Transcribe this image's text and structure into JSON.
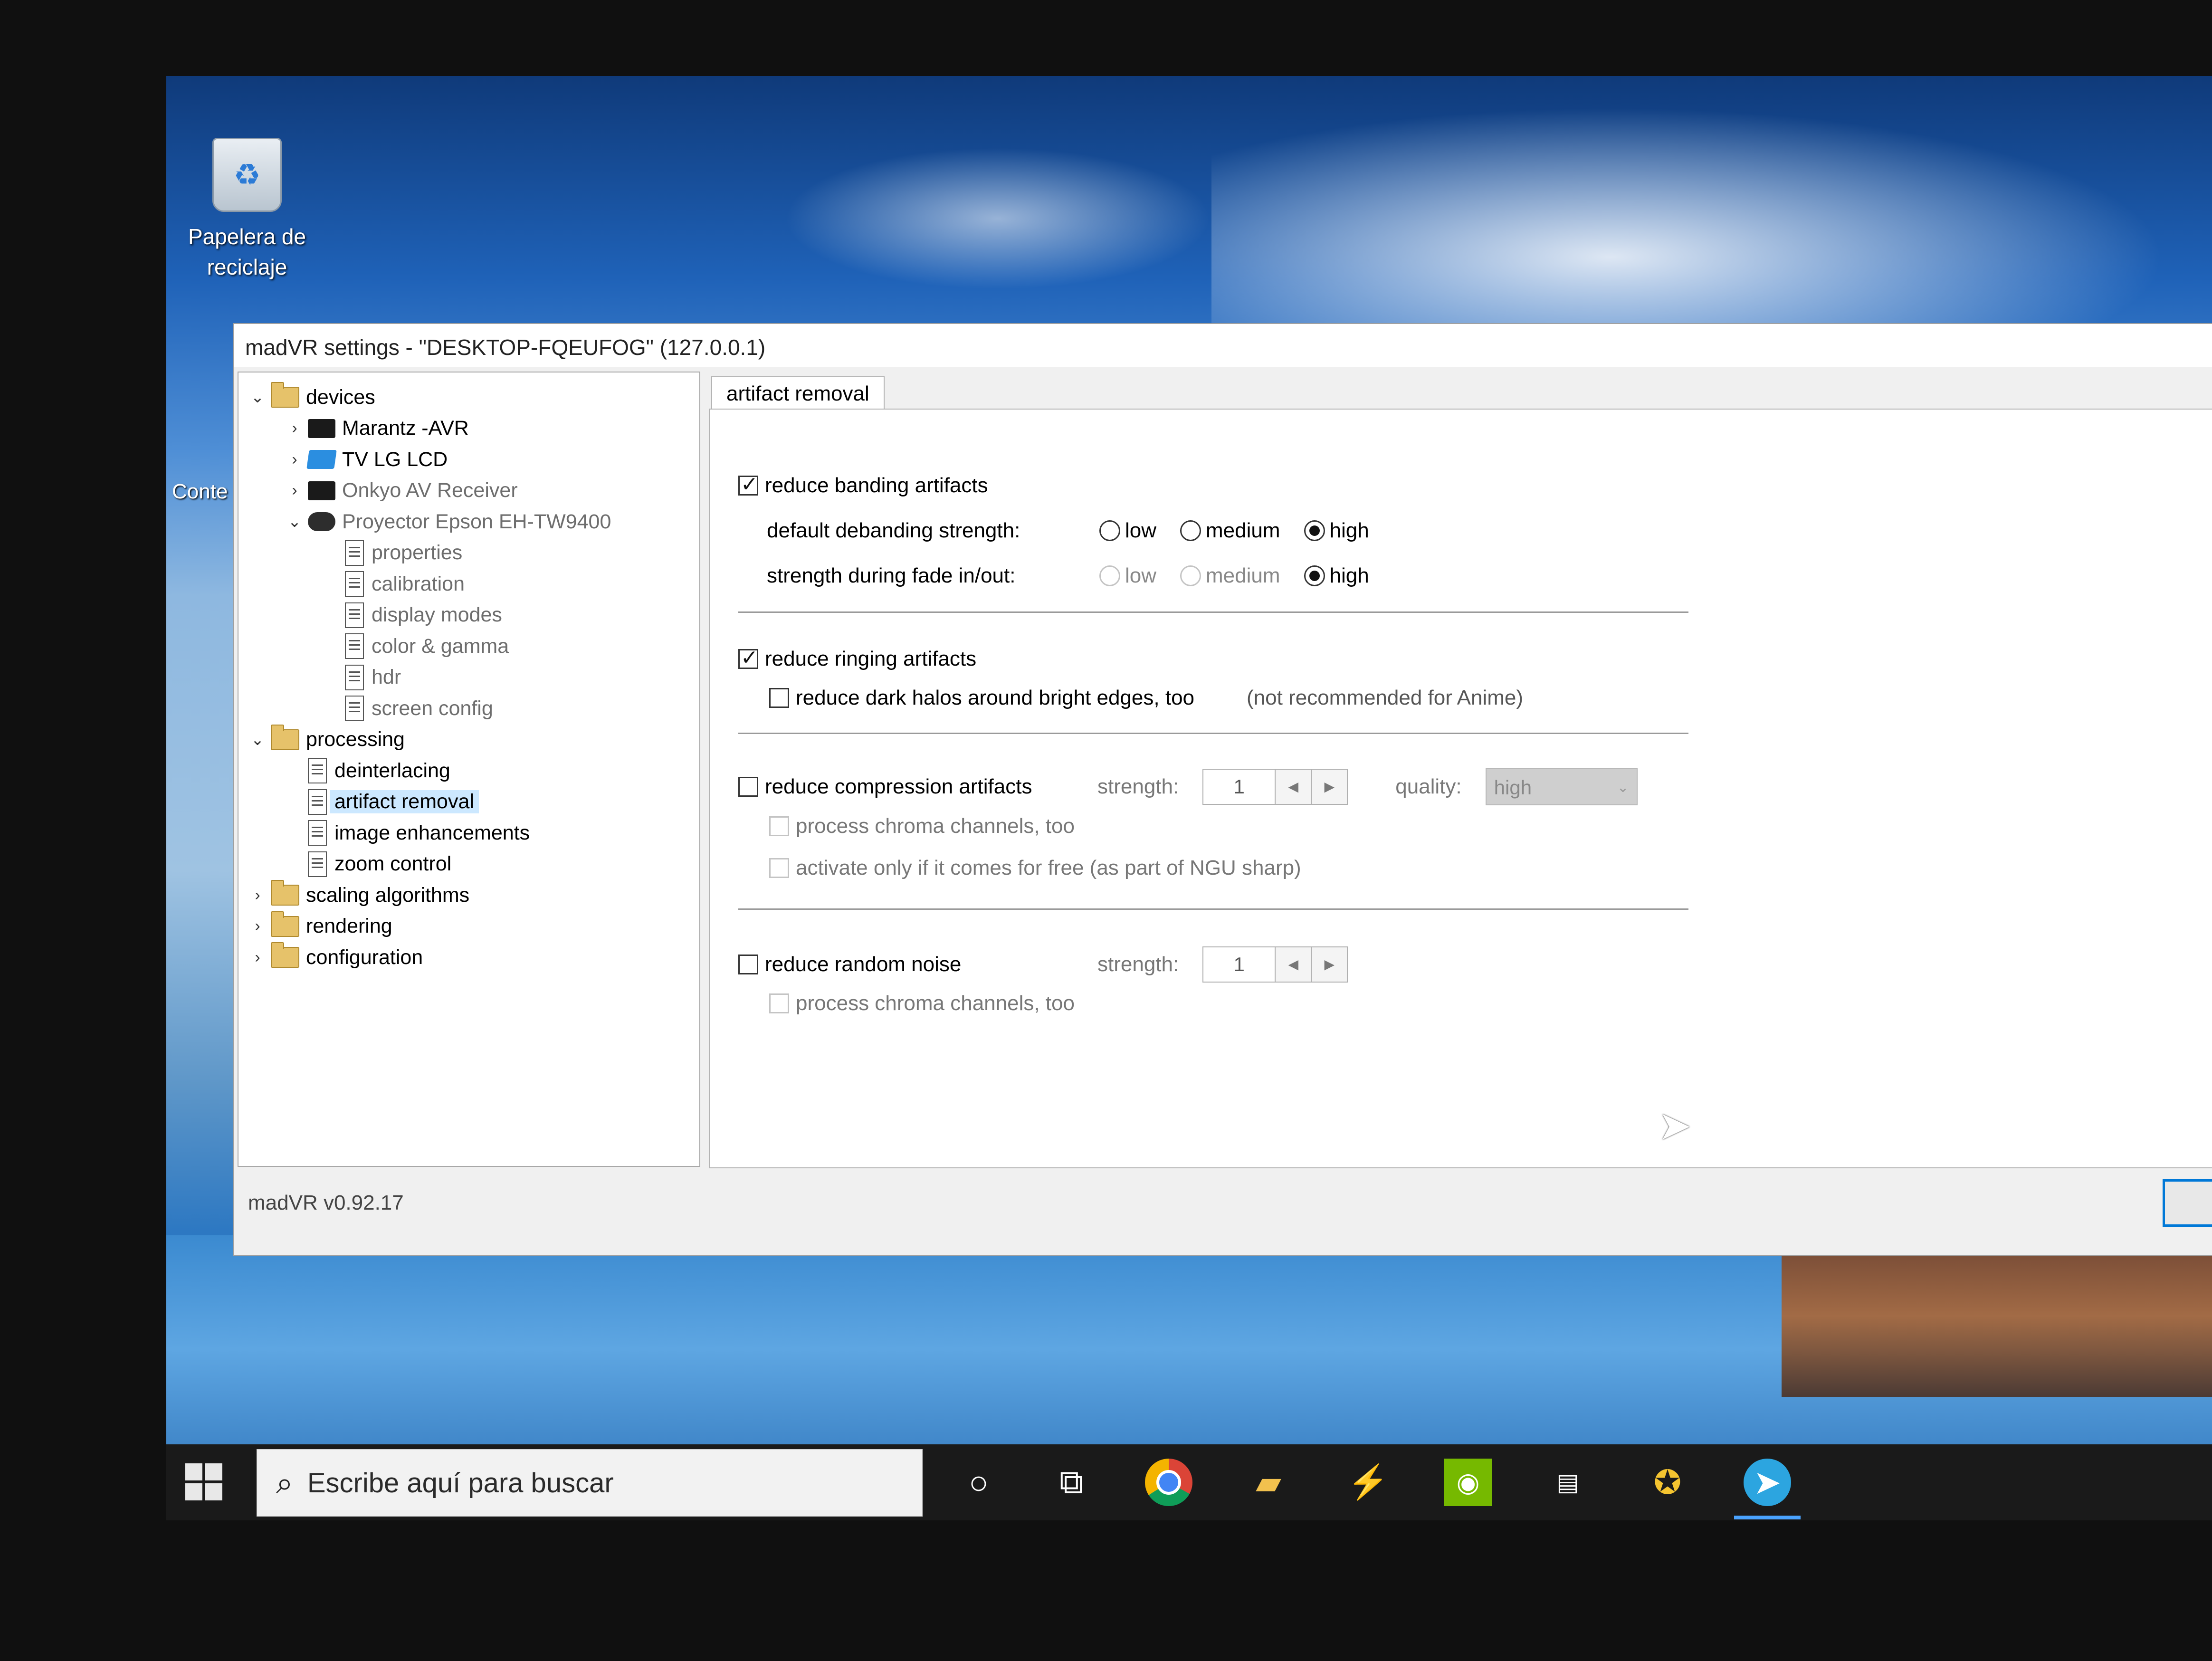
{
  "desktop": {
    "recycle_bin_label": "Papelera de reciclaje",
    "partial_icon_label": "Conte"
  },
  "window": {
    "title": "madVR settings - \"DESKTOP-FQEUFOG\" (127.0.0.1)",
    "status": "madVR v0.92.17"
  },
  "tree": [
    {
      "label": "devices",
      "icon": "folder-icon",
      "level": 0,
      "expanded": true
    },
    {
      "label": "Marantz -AVR",
      "icon": "receiver-icon",
      "level": 1,
      "expanded": false
    },
    {
      "label": "TV LG LCD",
      "icon": "tv-icon",
      "level": 1,
      "expanded": false
    },
    {
      "label": "Onkyo AV Receiver",
      "icon": "receiver-icon",
      "level": 1,
      "expanded": false,
      "dim": true
    },
    {
      "label": "Proyector Epson EH-TW9400",
      "icon": "projector-icon",
      "level": 1,
      "expanded": true,
      "dim": true
    },
    {
      "label": "properties",
      "icon": "page-icon",
      "level": 2,
      "dim": true
    },
    {
      "label": "calibration",
      "icon": "page-icon",
      "level": 2,
      "dim": true
    },
    {
      "label": "display modes",
      "icon": "page-icon",
      "level": 2,
      "dim": true
    },
    {
      "label": "color & gamma",
      "icon": "page-icon",
      "level": 2,
      "dim": true
    },
    {
      "label": "hdr",
      "icon": "page-icon",
      "level": 2,
      "dim": true
    },
    {
      "label": "screen config",
      "icon": "page-icon",
      "level": 2,
      "dim": true
    },
    {
      "label": "processing",
      "icon": "folder-icon",
      "level": 0,
      "expanded": true
    },
    {
      "label": "deinterlacing",
      "icon": "page-icon",
      "level": 1
    },
    {
      "label": "artifact removal",
      "icon": "page-icon",
      "level": 1,
      "selected": true
    },
    {
      "label": "image enhancements",
      "icon": "page-icon",
      "level": 1
    },
    {
      "label": "zoom control",
      "icon": "page-icon",
      "level": 1
    },
    {
      "label": "scaling algorithms",
      "icon": "folder-icon",
      "level": 0,
      "expanded": false
    },
    {
      "label": "rendering",
      "icon": "folder-icon",
      "level": 0,
      "expanded": false
    },
    {
      "label": "configuration",
      "icon": "folder-icon",
      "level": 0,
      "expanded": false
    }
  ],
  "tab": {
    "label": "artifact removal"
  },
  "banding": {
    "label": "reduce banding artifacts",
    "checked": true,
    "default_label": "default debanding strength:",
    "fade_label": "strength during fade in/out:",
    "options": [
      "low",
      "medium",
      "high"
    ],
    "default_value": "high",
    "fade_value": "high"
  },
  "ringing": {
    "label": "reduce ringing artifacts",
    "checked": true,
    "halos_label": "reduce dark halos around bright edges, too",
    "halos_checked": false,
    "note": "(not recommended for Anime)"
  },
  "compression": {
    "label": "reduce compression artifacts",
    "checked": false,
    "strength_label": "strength:",
    "strength_value": "1",
    "quality_label": "quality:",
    "quality_value": "high",
    "chroma_label": "process chroma channels, too",
    "free_label": "activate only if it comes for free (as part of NGU sharp)"
  },
  "noise": {
    "label": "reduce random noise",
    "checked": false,
    "strength_label": "strength:",
    "strength_value": "1",
    "chroma_label": "process chroma channels, too"
  },
  "taskbar": {
    "search_placeholder": "Escribe aquí para buscar",
    "icons": [
      "cortana-icon",
      "task-view-icon",
      "chrome-icon",
      "file-explorer-icon",
      "thunder-icon",
      "nvidia-icon",
      "mpc-hc-icon",
      "app-icon",
      "telegram-icon"
    ]
  },
  "colors": {
    "selection": "#cce8ff",
    "accent": "#0078d7"
  }
}
